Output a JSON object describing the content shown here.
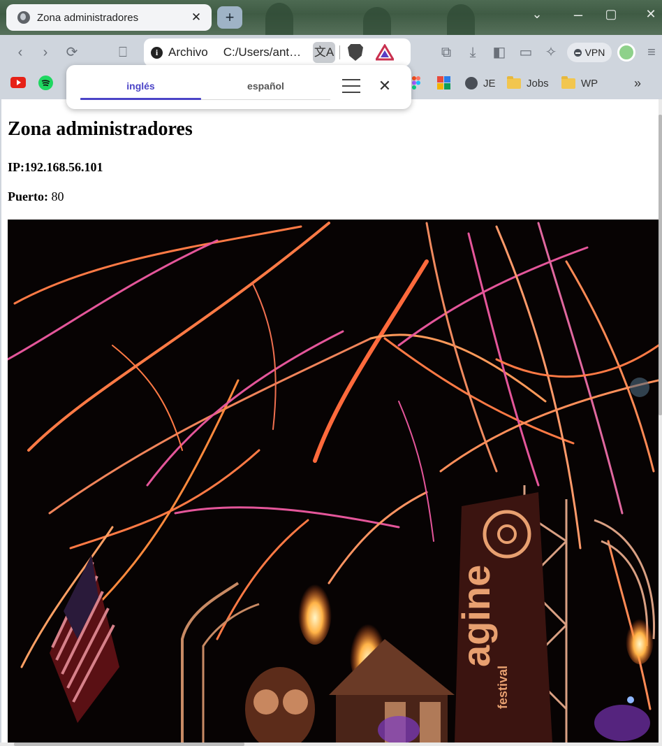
{
  "browser": {
    "tab": {
      "title": "Zona administradores",
      "close_glyph": "✕"
    },
    "new_tab_glyph": "+",
    "window_controls": {
      "minimize": "⌄",
      "maximize": "▢",
      "close": "✕"
    },
    "address_bar": {
      "scheme_label": "Archivo",
      "url": "C:/Users/ant…",
      "info_glyph": "i",
      "translate_glyph": "文A"
    },
    "vpn_label": "VPN",
    "bookmarks": [
      {
        "label": "JE",
        "icon": "globe-icon"
      },
      {
        "label": "Jobs",
        "icon": "folder-icon"
      },
      {
        "label": "WP",
        "icon": "folder-icon"
      }
    ],
    "bookmarks_overflow": "»"
  },
  "translate_popup": {
    "source_language": "inglés",
    "target_language": "español",
    "close_glyph": "✕"
  },
  "page": {
    "heading": "Zona administradores",
    "ip_line": "IP:192.168.56.101",
    "port_label": "Puerto:",
    "port_value": "80"
  },
  "image": {
    "banner_letters": "agine",
    "banner_small": "festival"
  },
  "colors": {
    "accent": "#4b44c7",
    "toolbar_bg": "#cfd5dd",
    "streamer_orange": "#ff7a45",
    "streamer_pink": "#e4569a"
  }
}
